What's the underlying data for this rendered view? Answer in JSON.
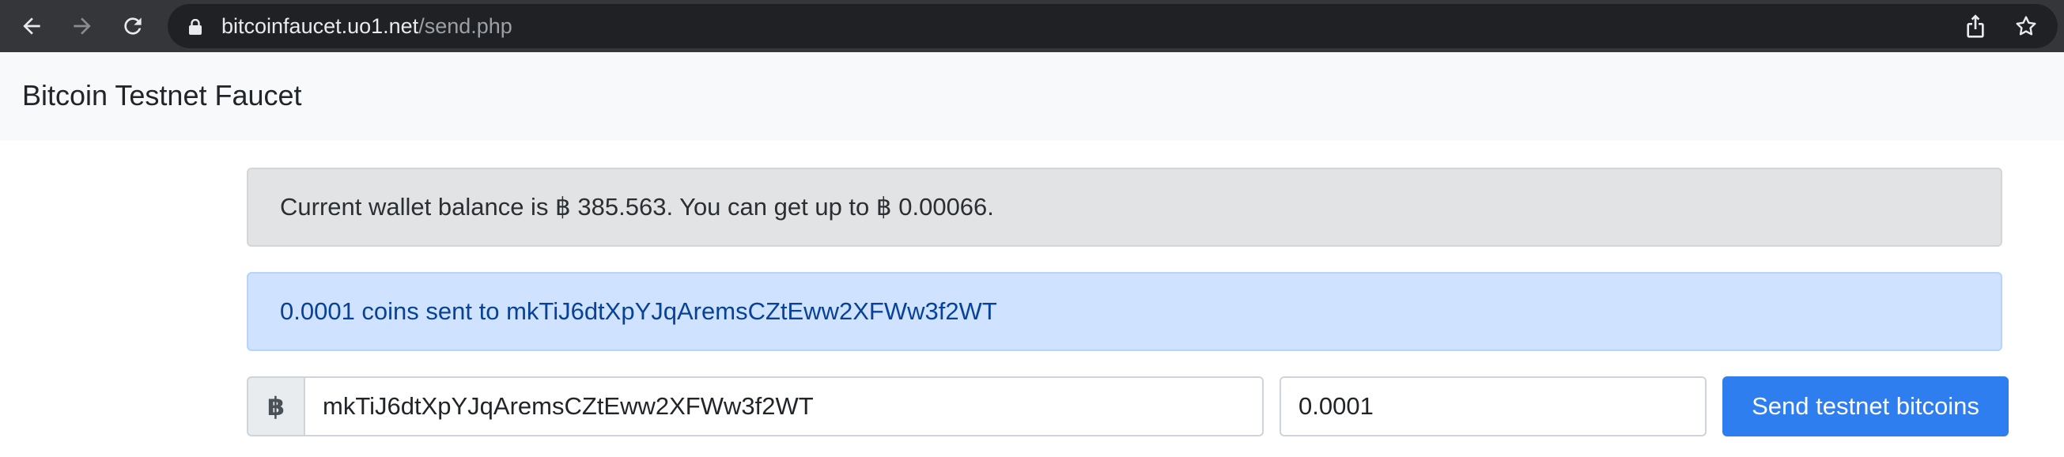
{
  "browser": {
    "url_host": "bitcoinfaucet.uo1.net",
    "url_path": "/send.php",
    "icons": [
      "back-icon",
      "forward-icon",
      "reload-icon",
      "lock-icon",
      "share-icon",
      "bookmark-star-icon"
    ]
  },
  "navbar": {
    "brand": "Bitcoin Testnet Faucet"
  },
  "balance_alert": {
    "text": "Current wallet balance is ฿ 385.563. You can get up to ฿ 0.00066."
  },
  "success_alert": {
    "text": "0.0001 coins sent to mkTiJ6dtXpYJqAremsCZtEww2XFWw3f2WT"
  },
  "form": {
    "currency_symbol": "฿",
    "address_value": "mkTiJ6dtXpYJqAremsCZtEww2XFWw3f2WT",
    "amount_value": "0.0001",
    "submit_label": "Send testnet bitcoins"
  },
  "colors": {
    "primary": "#2f7ef0",
    "info_bg": "#cfe2ff",
    "info_text": "#084298",
    "secondary_bg": "#e2e3e5"
  }
}
